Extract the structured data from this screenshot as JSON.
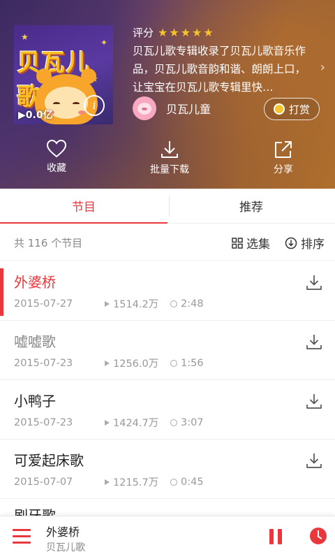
{
  "album": {
    "cover_text": "贝瓦儿歌",
    "plays": "0.0亿",
    "rating_label": "评分",
    "rating_stars": 5,
    "description": "贝瓦儿歌专辑收录了贝瓦儿歌音乐作品，贝瓦儿歌音韵和谐、朗朗上口，让宝宝在贝瓦儿歌专辑里快…",
    "author": "贝瓦儿童",
    "tip_label": "打赏"
  },
  "actions": {
    "favorite": "收藏",
    "batch_download": "批量下载",
    "share": "分享"
  },
  "tabs": [
    "节目",
    "推荐"
  ],
  "list": {
    "count": "共 116 个节目",
    "select_label": "选集",
    "sort_label": "排序"
  },
  "tracks": [
    {
      "title": "外婆桥",
      "date": "2015-07-27",
      "plays": "1514.2万",
      "duration": "2:48"
    },
    {
      "title": "嘘嘘歌",
      "date": "2015-07-23",
      "plays": "1256.0万",
      "duration": "1:56"
    },
    {
      "title": "小鸭子",
      "date": "2015-07-23",
      "plays": "1424.7万",
      "duration": "3:07"
    },
    {
      "title": "可爱起床歌",
      "date": "2015-07-07",
      "plays": "1215.7万",
      "duration": "0:45"
    }
  ],
  "peek_title": "刷牙歌",
  "player": {
    "title": "外婆桥",
    "artist": "贝瓦儿歌"
  },
  "colors": {
    "accent": "#e8383d",
    "star": "#f6c32a"
  }
}
